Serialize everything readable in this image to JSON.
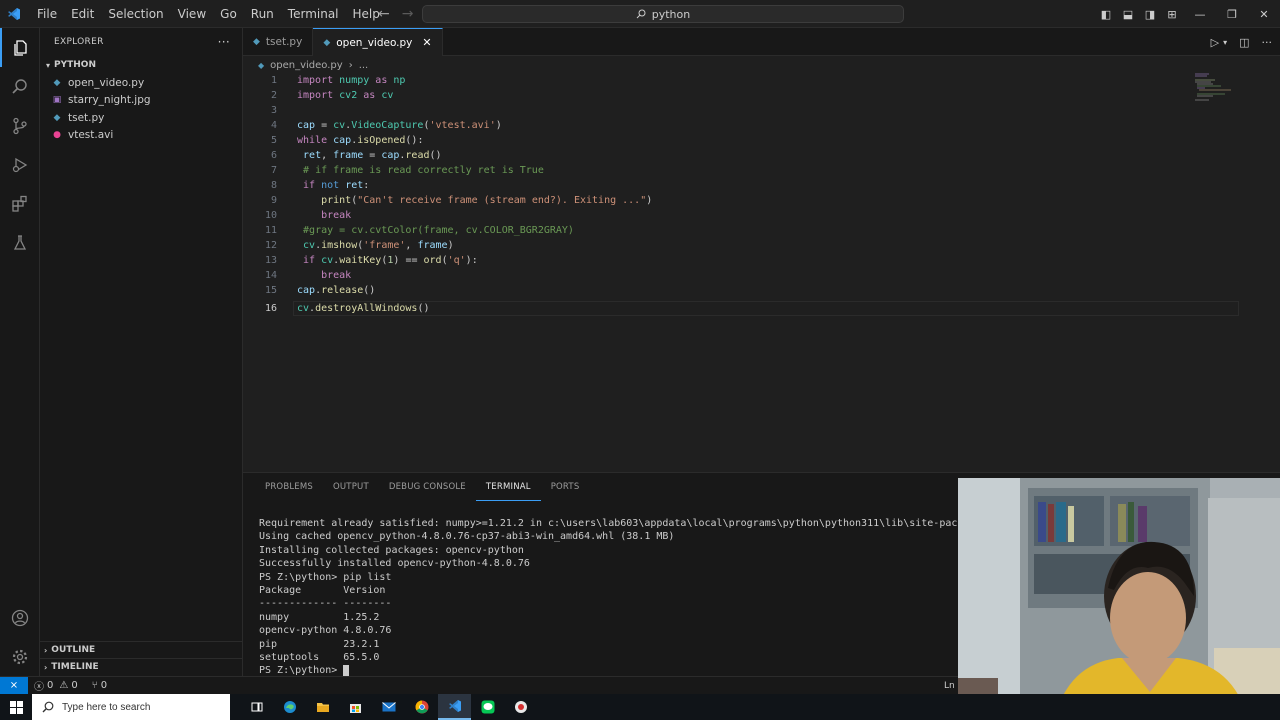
{
  "titlebar": {
    "menu": [
      "File",
      "Edit",
      "Selection",
      "View",
      "Go",
      "Run",
      "Terminal",
      "Help"
    ],
    "search_text": "python"
  },
  "sidebar": {
    "title": "EXPLORER",
    "folder": "PYTHON",
    "files": [
      {
        "name": "open_video.py",
        "icon": "python-file-icon",
        "color": "#519aba"
      },
      {
        "name": "starry_night.jpg",
        "icon": "image-file-icon",
        "color": "#a074c4"
      },
      {
        "name": "tset.py",
        "icon": "python-file-icon",
        "color": "#519aba"
      },
      {
        "name": "vtest.avi",
        "icon": "video-file-icon",
        "color": "#e84393"
      }
    ],
    "outline": "OUTLINE",
    "timeline": "TIMELINE"
  },
  "tabs": [
    {
      "label": "tset.py",
      "active": false
    },
    {
      "label": "open_video.py",
      "active": true
    }
  ],
  "breadcrumb": {
    "file": "open_video.py",
    "rest": "..."
  },
  "editor": {
    "current_line": 16,
    "line_numbers": [
      "1",
      "2",
      "3",
      "4",
      "5",
      "6",
      "7",
      "8",
      "9",
      "10",
      "11",
      "12",
      "13",
      "14",
      "15",
      "16"
    ]
  },
  "panel": {
    "tabs": [
      "PROBLEMS",
      "OUTPUT",
      "DEBUG CONSOLE",
      "TERMINAL",
      "PORTS"
    ],
    "active_tab": "TERMINAL",
    "terminal_lines": [
      "Requirement already satisfied: numpy>=1.21.2 in c:\\users\\lab603\\appdata\\local\\programs\\python\\python311\\lib\\site-pack",
      "Using cached opencv_python-4.8.0.76-cp37-abi3-win_amd64.whl (38.1 MB)",
      "Installing collected packages: opencv-python",
      "Successfully installed opencv-python-4.8.0.76",
      "PS Z:\\python> pip list",
      "Package       Version",
      "------------- --------",
      "numpy         1.25.2",
      "opencv-python 4.8.0.76",
      "pip           23.2.1",
      "setuptools    65.5.0"
    ],
    "prompt": "PS Z:\\python> "
  },
  "statusbar": {
    "errors": "0",
    "warnings": "0",
    "ports": "0",
    "position": "Ln"
  },
  "taskbar": {
    "search_placeholder": "Type here to search"
  },
  "colors": {
    "accent": "#3b9ef5",
    "remote": "#0078d4"
  }
}
